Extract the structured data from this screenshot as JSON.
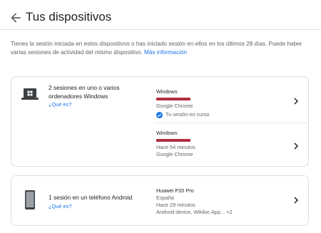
{
  "header": {
    "title": "Tus dispositivos"
  },
  "intro": {
    "text": "Tienes la sesión iniciada en estos dispositivos o has iniciado sesión en ellos en los últimos 28 días. Puede haber varias sesiones de actividad del mismo dispositivo.",
    "link": "Más información"
  },
  "devices": [
    {
      "summary": "2 sesiones en uno o varios ordenadores Windows",
      "link": "¿Qué es?",
      "icon": "laptop-icon",
      "sessions": [
        {
          "title": "Windows",
          "browser": "Google Chrome",
          "current": "Tu sesión en curso"
        },
        {
          "title": "Windows",
          "time": "Hace 54 minutos",
          "browser": "Google Chrome"
        }
      ]
    },
    {
      "summary": "1 sesión en un teléfono Android",
      "link": "¿Qué es?",
      "icon": "phone-icon",
      "sessions": [
        {
          "title": "Huawei P20 Pro",
          "location": "España",
          "time": "Hace 29 minutos",
          "apps": "Android device, Wikiloc App... +2"
        }
      ]
    }
  ],
  "colors": {
    "accent": "#1a73e8",
    "redaction": "#b03040",
    "border": "#dadce0"
  }
}
